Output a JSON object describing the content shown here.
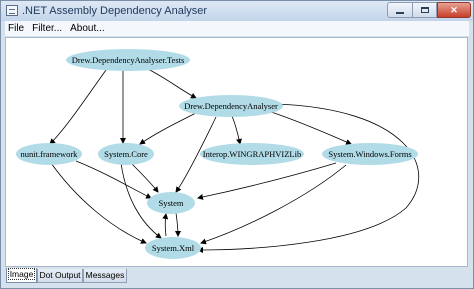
{
  "window": {
    "title": ".NET Assembly Dependency Analyser",
    "minimize_glyph": "minimize-icon",
    "maximize_glyph": "maximize-icon",
    "close_glyph": "✕"
  },
  "menu": {
    "items": [
      "File",
      "Filter...",
      "About..."
    ]
  },
  "graph": {
    "node_color": "#b0dbe7",
    "edge_color": "#000000",
    "nodes": {
      "tests": "Drew.DependencyAnalyser.Tests",
      "analyser": "Drew.DependencyAnalyser",
      "nunit": "nunit.framework",
      "core": "System.Core",
      "interop": "Interop.WINGRAPHVIZLib",
      "forms": "System.Windows.Forms",
      "system": "System",
      "xml": "System.Xml"
    }
  },
  "tabs": {
    "items": [
      "Image",
      "Dot Output",
      "Messages"
    ],
    "active": "Image"
  }
}
